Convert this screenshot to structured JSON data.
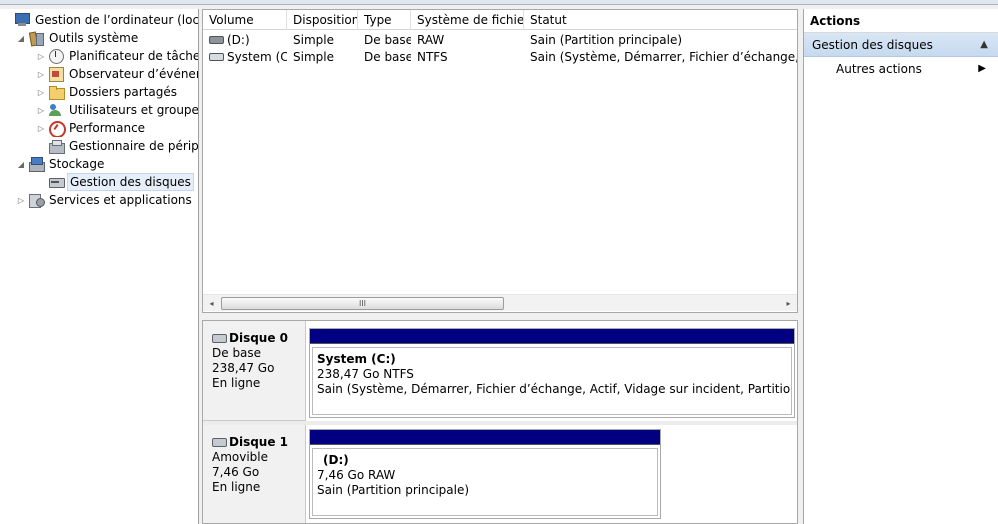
{
  "tree": {
    "root": "Gestion de l’ordinateur (local)",
    "system_tools": "Outils système",
    "task_scheduler": "Planificateur de tâches",
    "event_viewer": "Observateur d’événeme",
    "shared_folders": "Dossiers partagés",
    "users_groups": "Utilisateurs et groupes l",
    "performance": "Performance",
    "device_manager": "Gestionnaire de périphé",
    "storage": "Stockage",
    "disk_management": "Gestion des disques",
    "services_apps": "Services et applications"
  },
  "volume_list": {
    "columns": [
      "Volume",
      "Disposition",
      "Type",
      "Système de fichiers",
      "Statut"
    ],
    "rows": [
      {
        "volume": "(D:)",
        "layout": "Simple",
        "type": "De base",
        "fs": "RAW",
        "status": "Sain (Partition principale)"
      },
      {
        "volume": "System (C:)",
        "layout": "Simple",
        "type": "De base",
        "fs": "NTFS",
        "status": "Sain (Système, Démarrer, Fichier d’échange, Actif, V"
      }
    ],
    "scroll_grip": "III"
  },
  "disks": [
    {
      "name": "Disque 0",
      "kind": "De base",
      "size": "238,47 Go",
      "state": "En ligne",
      "partition": {
        "title": "System  (C:)",
        "size_fs": "238,47 Go NTFS",
        "status": "Sain (Système, Démarrer, Fichier d’échange, Actif, Vidage sur incident, Partition principale)"
      }
    },
    {
      "name": "Disque 1",
      "kind": "Amovible",
      "size": "7,46 Go",
      "state": "En ligne",
      "partition": {
        "title": "(D:)",
        "size_fs": "7,46 Go RAW",
        "status": "Sain (Partition principale)"
      }
    }
  ],
  "actions": {
    "title": "Actions",
    "section": "Gestion des disques",
    "more": "Autres actions"
  },
  "colors": {
    "partition_bar": "#000080",
    "selection": "#e5eef9",
    "actions_header": "#c6d9ef"
  },
  "icons": {
    "root": "computer-icon",
    "system_tools": "tools-icon",
    "task_scheduler": "clock-icon",
    "event_viewer": "event-viewer-icon",
    "shared_folders": "folder-icon",
    "users_groups": "users-icon",
    "performance": "performance-icon",
    "device_manager": "device-manager-icon",
    "storage": "storage-icon",
    "disk_management": "disk-icon",
    "services_apps": "services-icon"
  }
}
